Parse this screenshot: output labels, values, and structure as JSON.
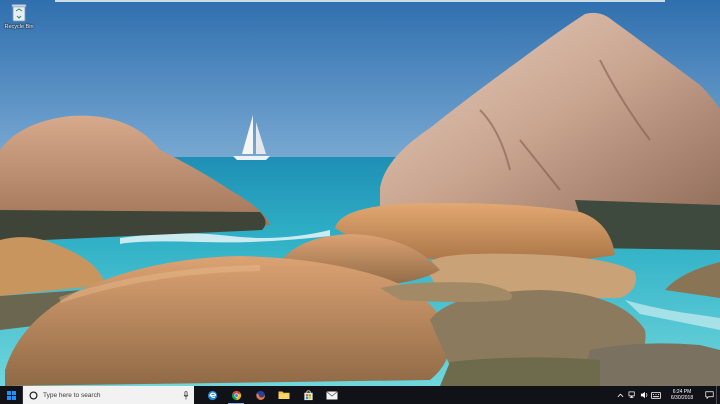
{
  "desktop": {
    "icons": [
      {
        "label": "Recycle Bin",
        "icon": "recycle-bin-icon"
      }
    ]
  },
  "taskbar": {
    "start_icon": "windows-logo-icon",
    "search": {
      "placeholder": "Type here to search",
      "icon": "cortana-circle-icon",
      "mic_icon": "microphone-icon"
    },
    "pinned": [
      {
        "name": "edge",
        "icon": "edge-icon"
      },
      {
        "name": "chrome",
        "icon": "chrome-icon"
      },
      {
        "name": "firefox",
        "icon": "firefox-icon"
      },
      {
        "name": "file-explorer",
        "icon": "folder-icon"
      },
      {
        "name": "store",
        "icon": "store-bag-icon"
      },
      {
        "name": "mail",
        "icon": "mail-icon"
      }
    ],
    "tray": {
      "icons": [
        "chevron-up-icon",
        "network-icon",
        "volume-icon",
        "keyboard-icon"
      ],
      "time": "6:24 PM",
      "date": "6/30/2018",
      "notification_icon": "action-center-icon"
    }
  },
  "colors": {
    "taskbar_bg": "#101217",
    "search_bg": "#f2f2f2",
    "accent": "#0078d7",
    "sky": "#3f7fb8",
    "sea": "#3fb6c6"
  }
}
